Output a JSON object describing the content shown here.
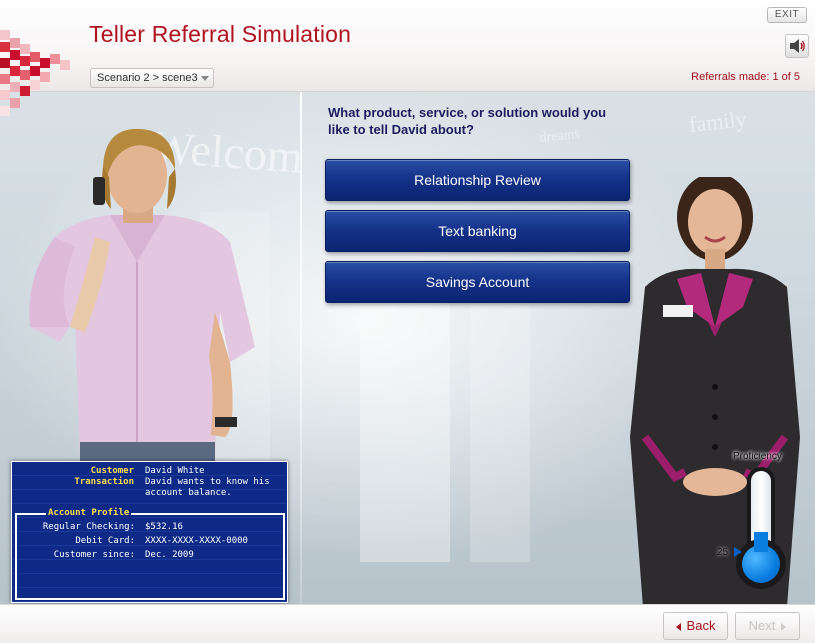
{
  "header": {
    "title": "Teller Referral Simulation",
    "exit_label": "EXIT",
    "audio_icon": "speaker-icon",
    "scenario_select": "Scenario 2 > scene3",
    "referrals_text": "Referrals made: 1 of 5"
  },
  "question": "What product, service, or solution would you like to tell David about?",
  "options": [
    {
      "label": "Relationship Review"
    },
    {
      "label": "Text banking"
    },
    {
      "label": "Savings Account"
    }
  ],
  "customer_panel": {
    "customer_label": "Customer",
    "customer_value": "David White",
    "transaction_label": "Transaction",
    "transaction_line1": "David wants to know his",
    "transaction_line2": "account balance.",
    "profile_title": "Account Profile",
    "rows": [
      {
        "label": "Regular Checking:",
        "value": "$532.16"
      },
      {
        "label": "Debit Card:",
        "value": "XXXX-XXXX-XXXX-0000"
      },
      {
        "label": "Customer since:",
        "value": "Dec. 2009"
      }
    ]
  },
  "proficiency": {
    "label": "Proficiency",
    "value_text": "25",
    "level_percent": 25,
    "fill_color": "#0a7de0"
  },
  "footer": {
    "back_label": "Back",
    "next_label": "Next"
  },
  "colors": {
    "brand_red": "#b1121f",
    "button_blue": "#15338a",
    "panel_blue": "#0e2a86",
    "panel_highlight": "#ffe04a"
  }
}
